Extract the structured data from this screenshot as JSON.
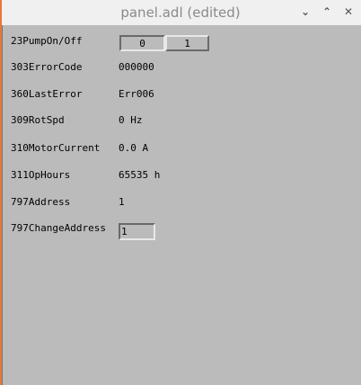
{
  "window": {
    "title": "panel.adl (edited)",
    "minimize": "⌄",
    "maximize": "⌃",
    "close": "✕"
  },
  "pump": {
    "label": "23PumpOn/Off",
    "options": [
      "0",
      "1"
    ],
    "selected": "0"
  },
  "rows": [
    {
      "label": "303ErrorCode",
      "value": "000000"
    },
    {
      "label": "360LastError",
      "value": "Err006"
    },
    {
      "label": "309RotSpd",
      "value": "0 Hz"
    },
    {
      "label": "310MotorCurrent",
      "value": "0.0 A"
    },
    {
      "label": "311OpHours",
      "value": "65535 h"
    },
    {
      "label": "797Address",
      "value": "1"
    }
  ],
  "change_address": {
    "label": "797ChangeAddress",
    "value": "1"
  }
}
